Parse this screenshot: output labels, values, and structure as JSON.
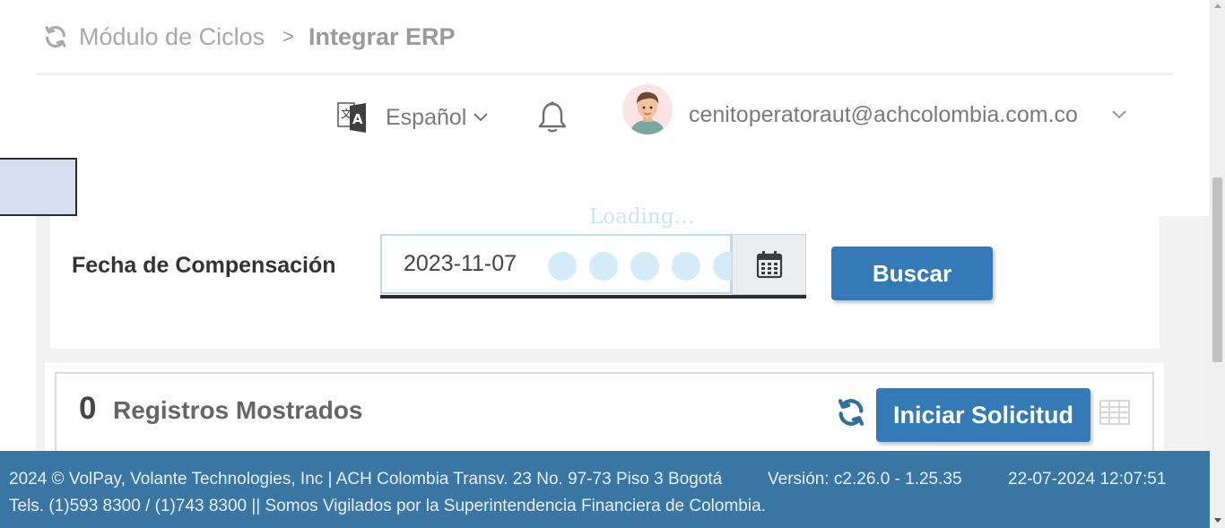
{
  "breadcrumb": {
    "parent": "Módulo de Ciclos",
    "separator": ">",
    "current": "Integrar ERP"
  },
  "header": {
    "language": "Español",
    "user_email": "cenitoperatoraut@achcolombia.com.co"
  },
  "loading_text": "Loading…",
  "search": {
    "date_label": "Fecha de Compensación",
    "date_value": "2023-11-07",
    "button_label": "Buscar"
  },
  "results": {
    "count": "0",
    "count_label": "Registros Mostrados",
    "start_button": "Iniciar Solicitud"
  },
  "footer": {
    "line1": "2024 © VolPay, Volante Technologies, Inc | ACH Colombia Transv. 23 No. 97-73 Piso 3 Bogotá",
    "version": "Versión: c2.26.0 - 1.25.35",
    "datetime": "22-07-2024 12:07:51",
    "line2": "Tels. (1)593 8300 / (1)743 8300 || Somos Vigilados por la Superintendencia Financiera de Colombia."
  },
  "colors": {
    "primary_button": "#337ab7",
    "footer_bg": "#3a76a4",
    "page_bg": "#f2f2f2"
  },
  "icons": [
    "refresh-icon",
    "chevron-right-icon",
    "translate-icon",
    "chevron-down-icon",
    "bell-icon",
    "user-avatar",
    "calendar-icon",
    "sync-icon",
    "grid-view-icon"
  ]
}
